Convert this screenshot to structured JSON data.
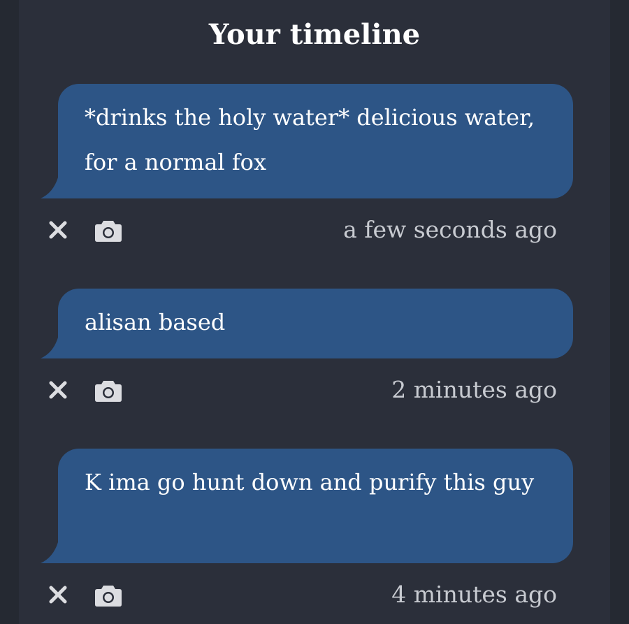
{
  "header": {
    "title": "Your timeline"
  },
  "posts": [
    {
      "text": "*drinks the holy water* delicious water, for a normal fox",
      "time": "a few seconds ago"
    },
    {
      "text": "alisan based",
      "time": "2 minutes ago"
    },
    {
      "text": "K ima go hunt down and purify this guy",
      "time": "4 minutes ago"
    }
  ],
  "icons": {
    "delete": "close-icon",
    "screenshot": "camera-icon"
  },
  "colors": {
    "background": "#2b2f3a",
    "bubble": "#2d5586",
    "text": "#ffffff",
    "timestamp": "#c8cbd1",
    "icon": "#dcdde1"
  }
}
